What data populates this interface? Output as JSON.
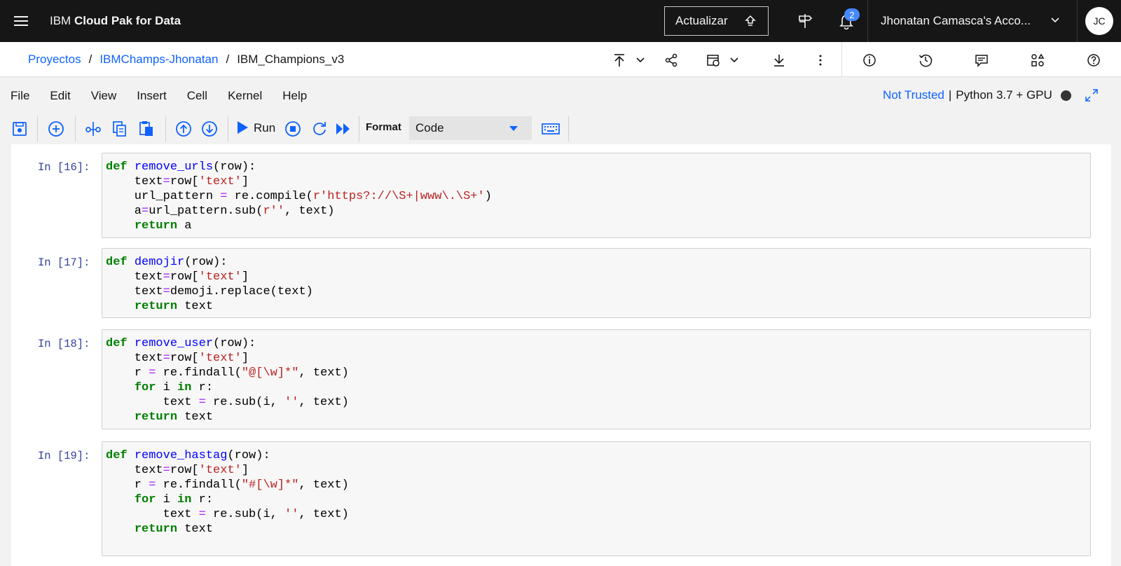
{
  "topbar": {
    "brand_prefix": "IBM ",
    "brand_name": "Cloud Pak for Data",
    "update_label": "Actualizar",
    "notification_count": "2",
    "account": "Jhonatan Camasca's Acco...",
    "avatar_initials": "JC"
  },
  "breadcrumb": {
    "items": [
      "Proyectos",
      "IBMChamps-Jhonatan"
    ],
    "current": "IBM_Champions_v3",
    "separator": "/"
  },
  "menu": {
    "items": [
      "File",
      "Edit",
      "View",
      "Insert",
      "Cell",
      "Kernel",
      "Help"
    ],
    "trust": "Not Trusted",
    "kernel": "Python 3.7 + GPU"
  },
  "toolbar": {
    "run_label": "Run",
    "format_label": "Format",
    "format_value": "Code"
  },
  "cells": [
    {
      "prompt": "In [16]:",
      "lines": [
        [
          [
            "kw",
            "def"
          ],
          [
            "t",
            " "
          ],
          [
            "fn",
            "remove_urls"
          ],
          [
            "t",
            "(row):"
          ]
        ],
        [
          [
            "t",
            "    text"
          ],
          [
            "op",
            "="
          ],
          [
            "t",
            "row["
          ],
          [
            "st",
            "'text'"
          ],
          [
            "t",
            "]"
          ]
        ],
        [
          [
            "t",
            "    url_pattern "
          ],
          [
            "op",
            "="
          ],
          [
            "t",
            " re.compile("
          ],
          [
            "st",
            "r'https?://\\S+|www\\.\\S+'"
          ],
          [
            "t",
            ")"
          ]
        ],
        [
          [
            "t",
            "    a"
          ],
          [
            "op",
            "="
          ],
          [
            "t",
            "url_pattern.sub("
          ],
          [
            "st",
            "r''"
          ],
          [
            "t",
            ", text)"
          ]
        ],
        [
          [
            "t",
            "    "
          ],
          [
            "kw",
            "return"
          ],
          [
            "t",
            " a"
          ]
        ]
      ]
    },
    {
      "prompt": "In [17]:",
      "lines": [
        [
          [
            "kw",
            "def"
          ],
          [
            "t",
            " "
          ],
          [
            "fn",
            "demojir"
          ],
          [
            "t",
            "(row):"
          ]
        ],
        [
          [
            "t",
            "    text"
          ],
          [
            "op",
            "="
          ],
          [
            "t",
            "row["
          ],
          [
            "st",
            "'text'"
          ],
          [
            "t",
            "]"
          ]
        ],
        [
          [
            "t",
            "    text"
          ],
          [
            "op",
            "="
          ],
          [
            "t",
            "demoji.replace(text)"
          ]
        ],
        [
          [
            "t",
            "    "
          ],
          [
            "kw",
            "return"
          ],
          [
            "t",
            " text"
          ]
        ]
      ]
    },
    {
      "prompt": "In [18]:",
      "lines": [
        [
          [
            "kw",
            "def"
          ],
          [
            "t",
            " "
          ],
          [
            "fn",
            "remove_user"
          ],
          [
            "t",
            "(row):"
          ]
        ],
        [
          [
            "t",
            "    text"
          ],
          [
            "op",
            "="
          ],
          [
            "t",
            "row["
          ],
          [
            "st",
            "'text'"
          ],
          [
            "t",
            "]"
          ]
        ],
        [
          [
            "t",
            "    r "
          ],
          [
            "op",
            "="
          ],
          [
            "t",
            " re.findall("
          ],
          [
            "st",
            "\"@[\\w]*\""
          ],
          [
            "t",
            ", text)"
          ]
        ],
        [
          [
            "t",
            "    "
          ],
          [
            "kw",
            "for"
          ],
          [
            "t",
            " i "
          ],
          [
            "kw",
            "in"
          ],
          [
            "t",
            " r:"
          ]
        ],
        [
          [
            "t",
            "        text "
          ],
          [
            "op",
            "="
          ],
          [
            "t",
            " re.sub(i, "
          ],
          [
            "st",
            "''"
          ],
          [
            "t",
            ", text)"
          ]
        ],
        [
          [
            "t",
            "    "
          ],
          [
            "kw",
            "return"
          ],
          [
            "t",
            " text"
          ]
        ]
      ]
    },
    {
      "prompt": "In [19]:",
      "lines": [
        [
          [
            "kw",
            "def"
          ],
          [
            "t",
            " "
          ],
          [
            "fn",
            "remove_hastag"
          ],
          [
            "t",
            "(row):"
          ]
        ],
        [
          [
            "t",
            "    text"
          ],
          [
            "op",
            "="
          ],
          [
            "t",
            "row["
          ],
          [
            "st",
            "'text'"
          ],
          [
            "t",
            "]"
          ]
        ],
        [
          [
            "t",
            "    r "
          ],
          [
            "op",
            "="
          ],
          [
            "t",
            " re.findall("
          ],
          [
            "st",
            "\"#[\\w]*\""
          ],
          [
            "t",
            ", text)"
          ]
        ],
        [
          [
            "t",
            "    "
          ],
          [
            "kw",
            "for"
          ],
          [
            "t",
            " i "
          ],
          [
            "kw",
            "in"
          ],
          [
            "t",
            " r:"
          ]
        ],
        [
          [
            "t",
            "        text "
          ],
          [
            "op",
            "="
          ],
          [
            "t",
            " re.sub(i, "
          ],
          [
            "st",
            "''"
          ],
          [
            "t",
            ", text)"
          ]
        ],
        [
          [
            "t",
            "    "
          ],
          [
            "kw",
            "return"
          ],
          [
            "t",
            " text"
          ]
        ],
        [
          [
            "t",
            ""
          ]
        ]
      ]
    }
  ]
}
